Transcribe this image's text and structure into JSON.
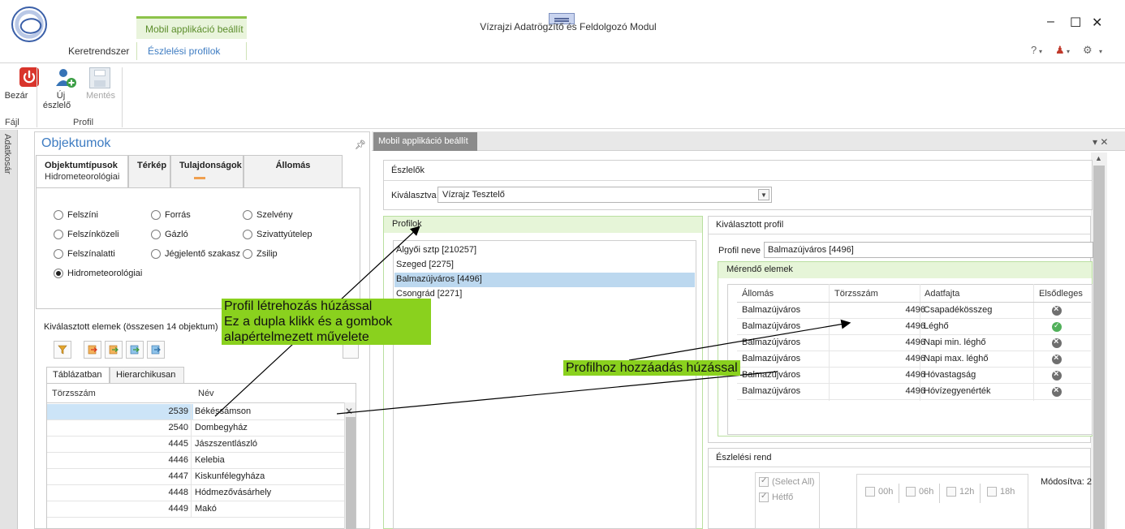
{
  "window": {
    "title": "Vízrajzi Adatrögzítő és Feldolgozó Modul",
    "minimize_glyph": "–",
    "maximize_glyph": "☐",
    "close_glyph": "✕",
    "help_glyph": "?",
    "user_glyph": "♟",
    "gear_glyph": "⚙"
  },
  "ribbon": {
    "context_tab": "Mobil applikáció beállít",
    "tabs": [
      "Keretrendszer",
      "Észlelési profilok"
    ],
    "buttons": {
      "close": "Bezár",
      "new_observer_line1": "Új",
      "new_observer_line2": "észlelő",
      "save": "Mentés"
    },
    "groups": {
      "file": "Fájl",
      "profile": "Profil"
    }
  },
  "side_strip": {
    "label": "Adatkosár"
  },
  "left_panel": {
    "title": "Objektumok",
    "tabs": {
      "types": "Objektumtípusok",
      "types_sub": "Hidrometeorológiai",
      "map": "Térkép",
      "props": "Tulajdonságok",
      "station": "Állomás"
    },
    "radios": [
      "Felszíni",
      "Forrás",
      "Szelvény",
      "Felszínközeli",
      "Gázló",
      "Szivattyútelep",
      "Felszínalatti",
      "Jégjelentő szakasz",
      "Zsilip",
      "Hidrometeorológiai"
    ],
    "selected_label": "Kiválasztott elemek (összesen 14 objektum)",
    "subtabs": [
      "Táblázatban",
      "Hierarchikusan"
    ],
    "grid": {
      "headers": [
        "Törzsszám",
        "Név"
      ],
      "rows": [
        {
          "id": "2539",
          "name": "Békéssámson"
        },
        {
          "id": "2540",
          "name": "Dombegyház"
        },
        {
          "id": "4445",
          "name": "Jászszentlászló"
        },
        {
          "id": "4446",
          "name": "Kelebia"
        },
        {
          "id": "4447",
          "name": "Kiskunfélegyháza"
        },
        {
          "id": "4448",
          "name": "Hódmezővásárhely"
        },
        {
          "id": "4449",
          "name": "Makó"
        }
      ]
    }
  },
  "document": {
    "tab": "Mobil applikáció beállít",
    "observers": {
      "title": "Észlelők",
      "select_label": "Kiválasztva",
      "select_value": "Vízrajz Tesztelő"
    },
    "profiles": {
      "title": "Profilok",
      "items": [
        "Algyői sztp [210257]",
        "Szeged  [2275]",
        "Balmazújváros  [4496]",
        "Csongrád  [2271]"
      ]
    },
    "selected_profile": {
      "title": "Kiválasztott profil",
      "name_label": "Profil neve",
      "name_value": "Balmazújváros  [4496]",
      "elements_title": "Mérendő elemek",
      "headers": [
        "Állomás",
        "Törzsszám",
        "Adatfajta",
        "Elsődleges"
      ],
      "rows": [
        {
          "station": "Balmazújváros",
          "id": "4496",
          "type": "Csapadékösszeg",
          "primary": "no"
        },
        {
          "station": "Balmazújváros",
          "id": "4496",
          "type": "Léghő",
          "primary": "yes"
        },
        {
          "station": "Balmazújváros",
          "id": "4496",
          "type": "Napi min. léghő",
          "primary": "no"
        },
        {
          "station": "Balmazújváros",
          "id": "4496",
          "type": "Napi max. léghő",
          "primary": "no"
        },
        {
          "station": "Balmazújváros",
          "id": "4496",
          "type": "Hóvastagság",
          "primary": "no"
        },
        {
          "station": "Balmazújváros",
          "id": "4496",
          "type": "Hóvízegyenérték",
          "primary": "no"
        }
      ]
    },
    "schedule": {
      "title": "Észlelési rend",
      "days": [
        "(Select All)",
        "Hétfő"
      ],
      "hours": [
        "00h",
        "06h",
        "12h",
        "18h"
      ],
      "modified": "Módosítva: 2"
    }
  },
  "annotations": {
    "note1_line1": "Profil létrehozás húzással",
    "note1_line2": "Ez a dupla klikk és a gombok",
    "note1_line3": "alapértelmezett művelete",
    "note2": "Profilhoz hozzáadás húzással"
  },
  "colors": {
    "accent_green": "#8cc34a",
    "accent_blue": "#3e7cc2",
    "callout_green": "#8ad11e",
    "selection_blue": "#bcd8ef"
  }
}
